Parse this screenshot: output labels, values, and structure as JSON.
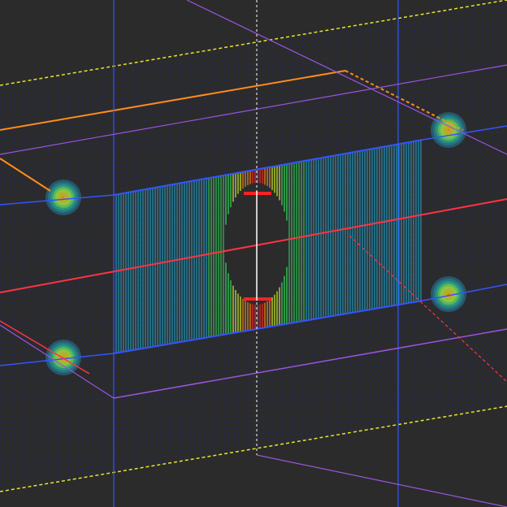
{
  "scene": {
    "background": "#2b2b2b",
    "colors": {
      "bounds_outer": "#e6e62a",
      "bounds_orange": "#ff8c1a",
      "plate_edge": "#3355ff",
      "axis_purple": "#9955dd",
      "axis_red": "#ff3344",
      "center_axis": "#ffffff",
      "field_low": "#1a2a9a",
      "field_mid": "#22aacc",
      "field_high": "#33dd33",
      "field_peak": "#ff2222"
    },
    "colormap": [
      "#1a2a9a",
      "#2266cc",
      "#22aacc",
      "#33dd55",
      "#ccee22",
      "#ff8800",
      "#ff2222"
    ]
  }
}
